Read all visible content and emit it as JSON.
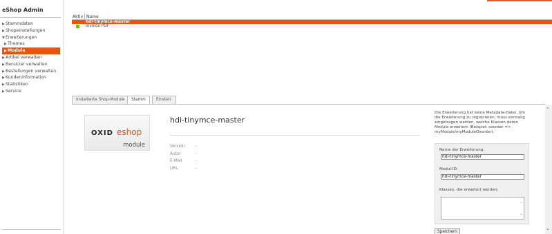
{
  "app": {
    "title": "eShop Admin",
    "accent_color": "#f24f10"
  },
  "sidebar": {
    "items": [
      {
        "label": "Stammdaten",
        "icon": "triangle-right-icon"
      },
      {
        "label": "Shopeinstellungen",
        "icon": "triangle-right-icon"
      },
      {
        "label": "Erweiterungen",
        "icon": "triangle-down-icon"
      },
      {
        "label": "Themes",
        "icon": "triangle-right-icon"
      },
      {
        "label": "Module",
        "icon": "triangle-right-icon",
        "active": true
      },
      {
        "label": "Artikel verwalten",
        "icon": "triangle-right-icon"
      },
      {
        "label": "Benutzer verwalten",
        "icon": "triangle-right-icon"
      },
      {
        "label": "Bestellungen verwalten",
        "icon": "triangle-right-icon"
      },
      {
        "label": "Kundeninformation",
        "icon": "triangle-right-icon"
      },
      {
        "label": "Statistiken",
        "icon": "triangle-right-icon"
      },
      {
        "label": "Service",
        "icon": "triangle-right-icon"
      }
    ]
  },
  "list": {
    "columns": {
      "aktiv": "Aktiv",
      "name": "Name"
    },
    "rows": [
      {
        "name": "hdi-tinymce-master",
        "active": false,
        "selected": true
      },
      {
        "name": "Invoice PDF",
        "active": true,
        "status_color": "#6dbf2a"
      }
    ]
  },
  "tabs": [
    {
      "label": "Installierte Shop-Module"
    },
    {
      "label": "Stamm",
      "active": true
    },
    {
      "label": "Einstell."
    }
  ],
  "logo": {
    "brand1": "OXID",
    "brand2": "eshop",
    "sub": "module"
  },
  "module": {
    "title": "hdi-tinymce-master",
    "meta": [
      {
        "label": "Version",
        "value": "-"
      },
      {
        "label": "Autor",
        "value": "-"
      },
      {
        "label": "E-Mail",
        "value": "-"
      },
      {
        "label": "URL",
        "value": "-"
      }
    ]
  },
  "panel": {
    "info": "Die Erweiterung hat keine Metadata-Datei. Um die Erweiterung zu registrieren, muss einmalig eingetragen werden, welche Klassen deren Module erweitern (Beispiel: oxorder => myModule/myModuleOxorder).",
    "name_label": "Name der Erweiterung:",
    "name_value": "hdi-tinymce-master",
    "id_label": "Modul-ID:",
    "id_value": "hdi-tinymce-master",
    "classes_label": "Klassen, die erweitert werden:",
    "save_label": "Speichern"
  }
}
